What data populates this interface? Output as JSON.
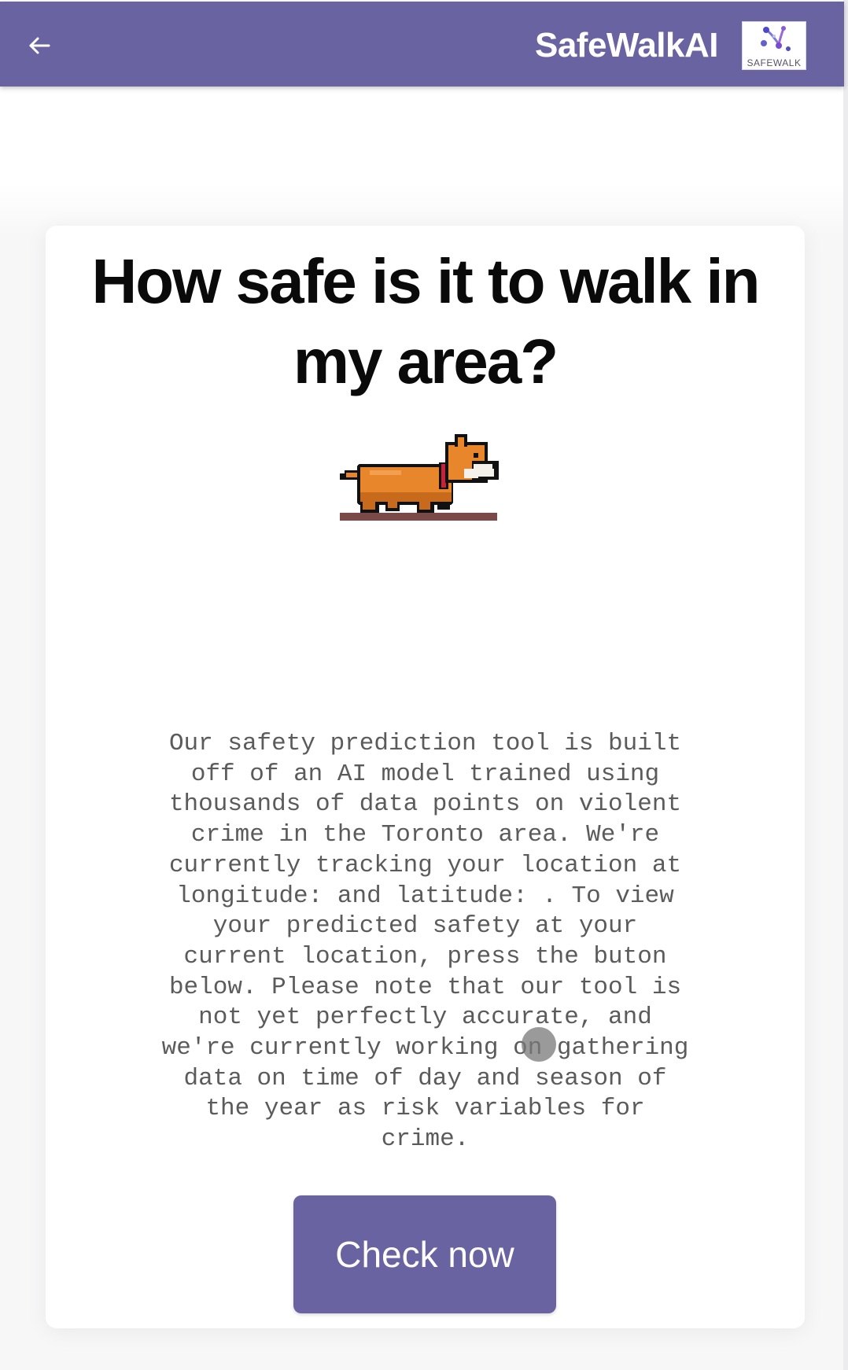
{
  "header": {
    "back_icon": "arrow-left-icon",
    "title": "SafeWalkAI",
    "logo_text": "SAFEWALK"
  },
  "main": {
    "headline": "How safe is it to walk in my area?",
    "illustration_icon": "pixel-dog-walking-icon",
    "description": "Our safety prediction tool is built off of an AI model trained using thousands of data points on violent crime in the Toronto area. We're currently tracking your location at longitude: and latitude: . To view your predicted safety at your current location, press the buton below. Please note that our tool is not yet perfectly accurate, and we're currently working on gathering data on time of day and season of the year as risk variables for crime.",
    "check_button_label": "Check now"
  },
  "colors": {
    "brand": "#6a63a2",
    "header_text": "#ffffff",
    "headline_text": "#0a0a0a",
    "body_text": "#5b5b5b"
  }
}
